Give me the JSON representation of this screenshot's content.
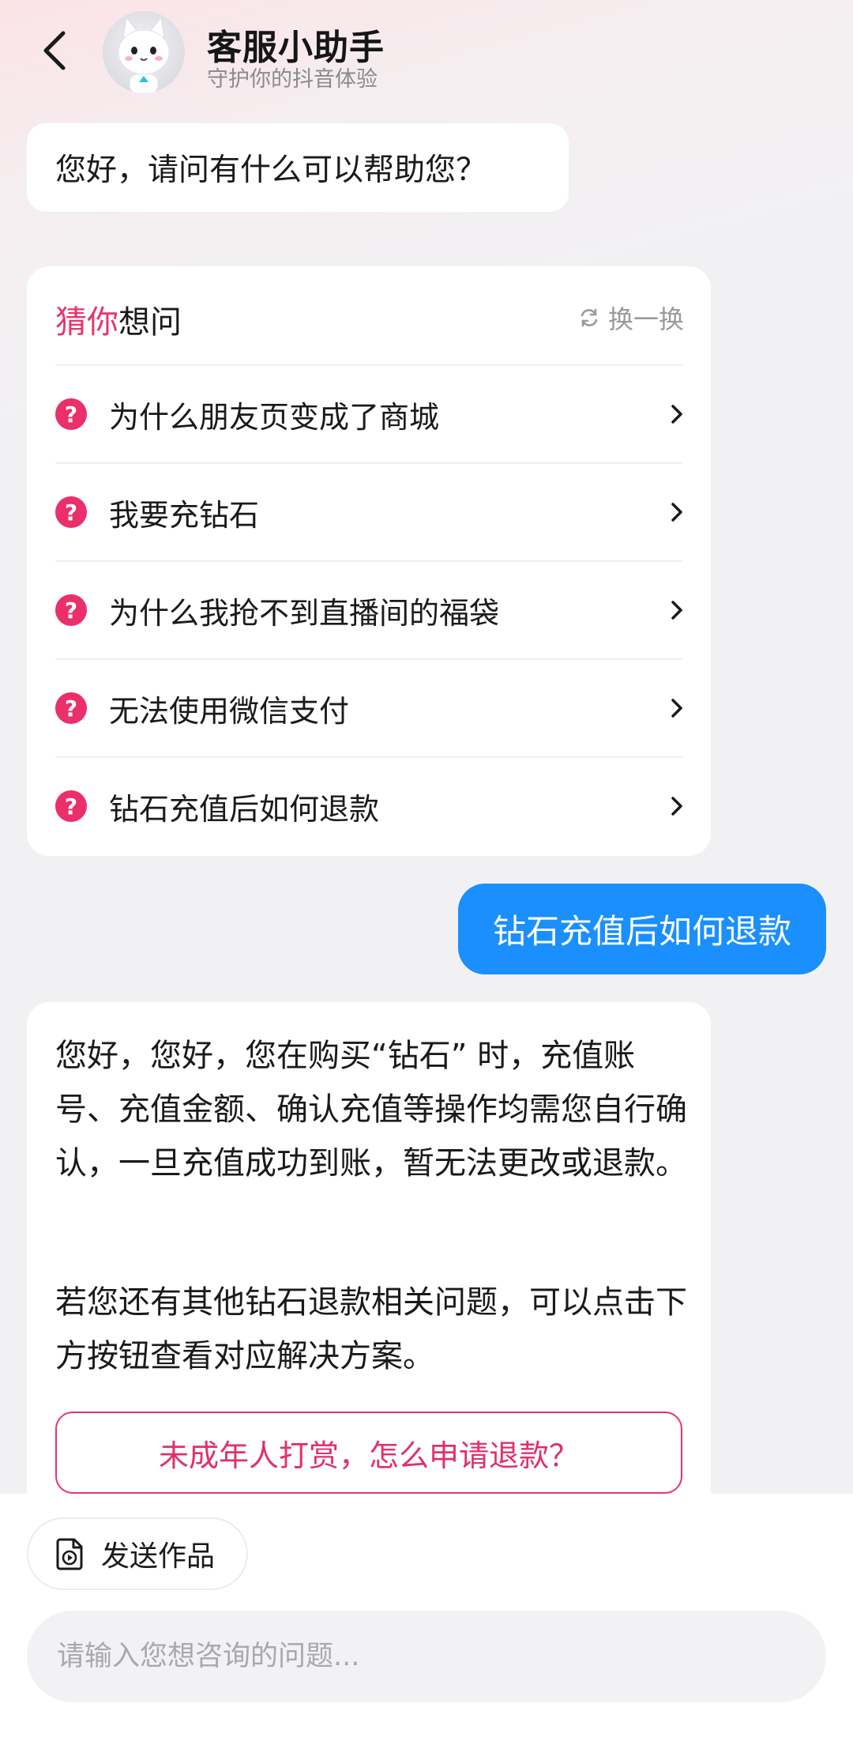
{
  "header": {
    "title": "客服小助手",
    "subtitle": "守护你的抖音体验"
  },
  "greeting": "您好，请问有什么可以帮助您？",
  "suggestions": {
    "title_highlight": "猜你",
    "title_rest": "想问",
    "refresh_label": "换一换",
    "items": [
      {
        "label": "为什么朋友页变成了商城"
      },
      {
        "label": "我要充钻石"
      },
      {
        "label": "为什么我抢不到直播间的福袋"
      },
      {
        "label": "无法使用微信支付"
      },
      {
        "label": "钻石充值后如何退款"
      }
    ]
  },
  "user_message": "钻石充值后如何退款",
  "answer": {
    "paragraph1": "您好，您好，您在购买“钻石” 时，充值账号、充值金额、确认充值等操作均需您自行确认，一旦充值成功到账，暂无法更改或退款。",
    "paragraph2": "若您还有其他钻石退款相关问题，可以点击下方按钮查看对应解决方案。",
    "button_label": "未成年人打赏，怎么申请退款？"
  },
  "composer": {
    "send_work_label": "发送作品",
    "input_placeholder": "请输入您想咨询的问题..."
  },
  "colors": {
    "accent_pink": "#e8336b",
    "bubble_blue": "#1a8ffd"
  },
  "icons": [
    "back-arrow-icon",
    "refresh-icon",
    "question-icon",
    "chevron-right-icon",
    "video-file-icon"
  ]
}
